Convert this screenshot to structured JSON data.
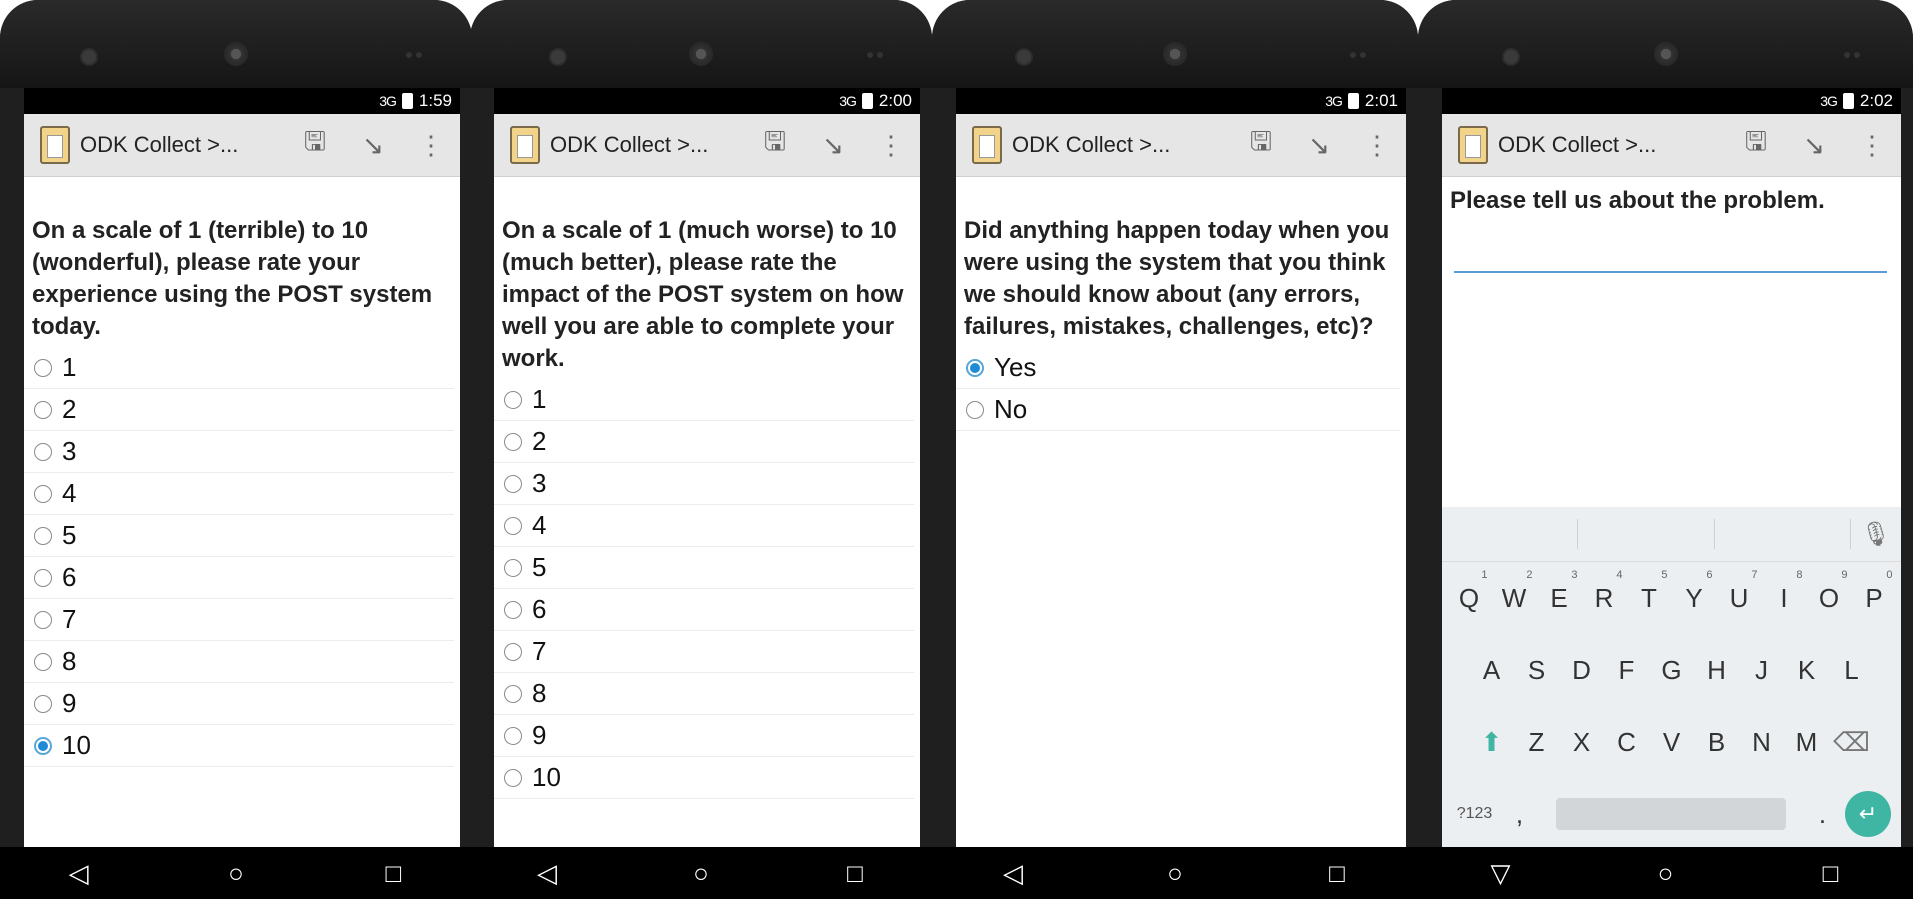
{
  "app": {
    "title": "ODK Collect >...",
    "accent": "#1f8ad6"
  },
  "icons": {
    "save": "save-icon",
    "jump": "jump-icon",
    "menu": "overflow-menu-icon",
    "app": "clipboard-icon"
  },
  "phones": [
    {
      "time": "1:59",
      "network": "3G",
      "question": "On a scale of 1 (terrible) to 10 (wonderful), please rate your experience using the POST system today.",
      "options": [
        "1",
        "2",
        "3",
        "4",
        "5",
        "6",
        "7",
        "8",
        "9",
        "10"
      ],
      "selected_index": 9
    },
    {
      "time": "2:00",
      "network": "3G",
      "question": "On a scale of 1 (much worse) to 10 (much better), please rate the impact of the POST system on how well you are able to complete your work.",
      "options": [
        "1",
        "2",
        "3",
        "4",
        "5",
        "6",
        "7",
        "8",
        "9",
        "10"
      ],
      "selected_index": -1
    },
    {
      "time": "2:01",
      "network": "3G",
      "question": "Did anything happen today when you were using the system that you think we should know about (any errors, failures, mistakes, challenges, etc)?",
      "options": [
        "Yes",
        "No"
      ],
      "selected_index": 0
    },
    {
      "time": "2:02",
      "network": "3G",
      "question": "Please tell us about the problem.",
      "text_value": ""
    }
  ],
  "keyboard": {
    "row1": [
      [
        "Q",
        "1"
      ],
      [
        "W",
        "2"
      ],
      [
        "E",
        "3"
      ],
      [
        "R",
        "4"
      ],
      [
        "T",
        "5"
      ],
      [
        "Y",
        "6"
      ],
      [
        "U",
        "7"
      ],
      [
        "I",
        "8"
      ],
      [
        "O",
        "9"
      ],
      [
        "P",
        "0"
      ]
    ],
    "row2": [
      "A",
      "S",
      "D",
      "F",
      "G",
      "H",
      "J",
      "K",
      "L"
    ],
    "row3": [
      "Z",
      "X",
      "C",
      "V",
      "B",
      "N",
      "M"
    ],
    "symbols_label": "?123",
    "comma": ",",
    "period": "."
  }
}
